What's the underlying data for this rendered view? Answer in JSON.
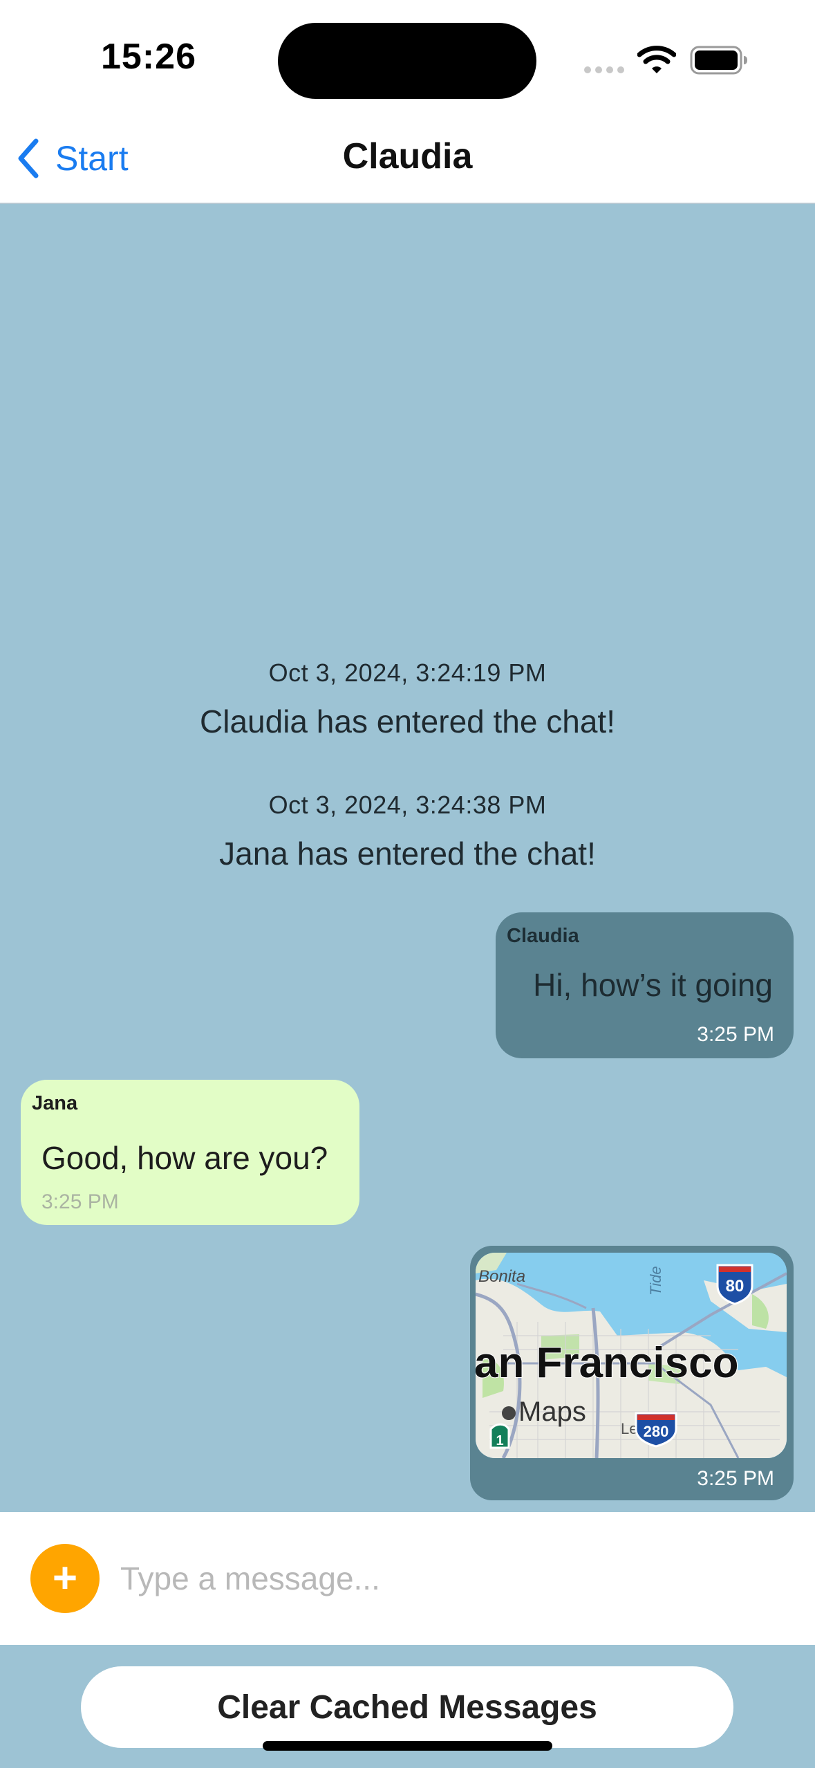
{
  "status_bar": {
    "time": "15:26"
  },
  "nav": {
    "back_label": "Start",
    "title": "Claudia"
  },
  "colors": {
    "chat_background": "#9DC3D4",
    "outgoing_bubble": "#5A8391",
    "incoming_bubble": "#E2FDC6",
    "accent": "#1A7CF0",
    "add_button": "#FFA500"
  },
  "system_messages": [
    {
      "timestamp": "Oct 3, 2024, 3:24:19 PM",
      "text": "Claudia has entered the chat!"
    },
    {
      "timestamp": "Oct 3, 2024, 3:24:38 PM",
      "text": "Jana has entered the chat!"
    }
  ],
  "messages": [
    {
      "direction": "outgoing",
      "sender": "Claudia",
      "text": "Hi, how’s it going",
      "time": "3:25 PM"
    },
    {
      "direction": "incoming",
      "sender": "Jana",
      "text": "Good, how are you?",
      "time": "3:25 PM"
    },
    {
      "direction": "outgoing",
      "type": "location",
      "time": "3:25 PM",
      "map": {
        "city_label": "an Francisco",
        "labels": [
          "Bonita",
          "Tide",
          "Le"
        ],
        "badge": "Maps",
        "shields": [
          "80",
          "280",
          "1"
        ]
      }
    }
  ],
  "composer": {
    "add_icon": "plus-icon",
    "placeholder": "Type a message..."
  },
  "footer": {
    "clear_label": "Clear Cached Messages"
  }
}
